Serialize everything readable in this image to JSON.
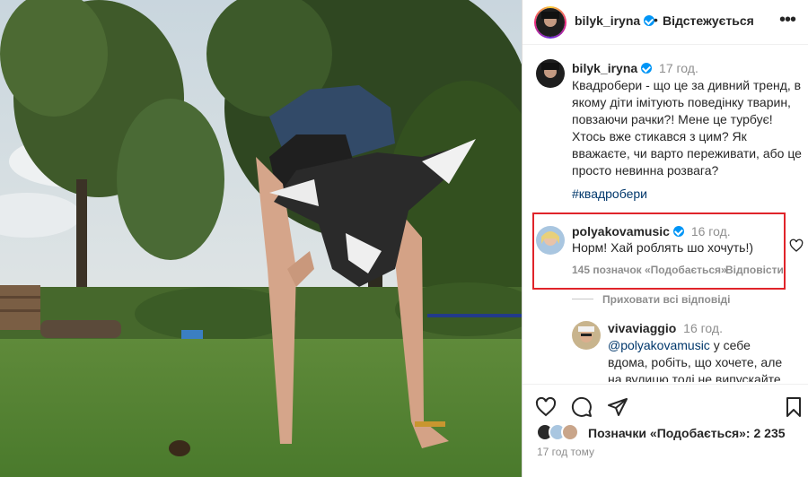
{
  "header": {
    "username": "bilyk_iryna",
    "separator": "•",
    "follow_label": "Відстежується",
    "more_icon": "more-horizontal-icon"
  },
  "caption": {
    "username": "bilyk_iryna",
    "time": "17 год.",
    "text": "Квадробери - що це за дивний тренд, в якому діти імітують поведінку тварин, повзаючи рачки?! Мене це турбує! Хтось вже стикався з цим? Як вважаєте, чи варто переживати, або це просто невинна розвага?",
    "hashtag": "#квадробери"
  },
  "comments": [
    {
      "username": "polyakovamusic",
      "time": "16 год.",
      "text": "Норм! Хай роблять шо хочуть!)",
      "likes": "145 позначок «Подобається»",
      "reply_label": "Відповісти",
      "highlight_color": "#e0242a"
    }
  ],
  "hide_replies_label": "Приховати всі відповіді",
  "replies": [
    {
      "username": "vivaviaggio",
      "time": "16 год.",
      "mention": "@polyakovamusic",
      "text": " у себе вдома, робіть, що хочете, але на вулицю тоді не випускайте,"
    }
  ],
  "actions": {
    "icons": [
      "heart-icon",
      "comment-icon",
      "share-icon",
      "bookmark-icon"
    ],
    "likes_text": "Позначки «Подобається»: 2 235",
    "post_time": "17 год тому"
  },
  "colors": {
    "verified": "#0095f6",
    "link": "#00376b",
    "muted": "#8e8e8e",
    "highlight": "#e0242a"
  }
}
